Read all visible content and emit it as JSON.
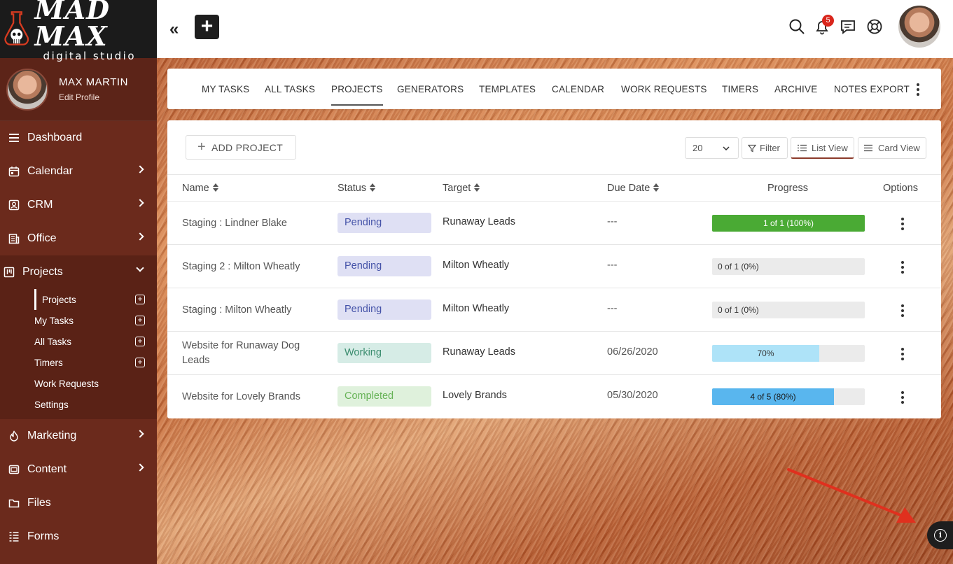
{
  "brand": {
    "name": "MAD MAX",
    "tagline": "digital studio"
  },
  "profile": {
    "name": "MAX MARTIN",
    "edit_label": "Edit Profile"
  },
  "sidebar": {
    "items": [
      {
        "label": "Dashboard",
        "icon": "menu-lines-icon"
      },
      {
        "label": "Calendar",
        "icon": "calendar-icon"
      },
      {
        "label": "CRM",
        "icon": "contact-card-icon"
      },
      {
        "label": "Office",
        "icon": "office-building-icon"
      },
      {
        "label": "Projects",
        "icon": "projects-board-icon"
      },
      {
        "label": "Marketing",
        "icon": "flame-icon"
      },
      {
        "label": "Content",
        "icon": "content-window-icon"
      },
      {
        "label": "Files",
        "icon": "folder-icon"
      },
      {
        "label": "Forms",
        "icon": "form-list-icon"
      }
    ],
    "project_subitems": [
      {
        "label": "Projects",
        "has_add": true
      },
      {
        "label": "My Tasks",
        "has_add": true
      },
      {
        "label": "All Tasks",
        "has_add": true
      },
      {
        "label": "Timers",
        "has_add": true
      },
      {
        "label": "Work Requests",
        "has_add": false
      },
      {
        "label": "Settings",
        "has_add": false
      }
    ]
  },
  "topbar": {
    "notification_count": "5"
  },
  "tabs": [
    "MY TASKS",
    "ALL TASKS",
    "PROJECTS",
    "GENERATORS",
    "TEMPLATES",
    "CALENDAR",
    "WORK REQUESTS",
    "TIMERS",
    "ARCHIVE",
    "NOTES EXPORT"
  ],
  "active_tab": "PROJECTS",
  "toolbar": {
    "add_project": "ADD PROJECT",
    "page_size": "20",
    "filter": "Filter",
    "list_view": "List View",
    "card_view": "Card View"
  },
  "table": {
    "headers": {
      "name": "Name",
      "status": "Status",
      "target": "Target",
      "due": "Due Date",
      "progress": "Progress",
      "options": "Options"
    },
    "rows": [
      {
        "name": "Staging : Lindner Blake",
        "status": "Pending",
        "target": "Runaway Leads",
        "due": "---",
        "progress_label": "1 of 1 (100%)",
        "progress": 1.0,
        "bar_color": "#4aaa34",
        "label_color": "#ffffff"
      },
      {
        "name": "Staging 2 : Milton Wheatly",
        "status": "Pending",
        "target": "Milton Wheatly",
        "due": "---",
        "progress_label": "0 of 1 (0%)",
        "progress": 0.0,
        "bar_color": "#4aaa34",
        "label_color": "#333333"
      },
      {
        "name": "Staging : Milton Wheatly",
        "status": "Pending",
        "target": "Milton Wheatly",
        "due": "---",
        "progress_label": "0 of 1 (0%)",
        "progress": 0.0,
        "bar_color": "#4aaa34",
        "label_color": "#333333"
      },
      {
        "name": "Website for Runaway Dog Leads",
        "status": "Working",
        "target": "Runaway Leads",
        "due": "06/26/2020",
        "progress_label": "70%",
        "progress": 0.7,
        "bar_color": "#aee3f8",
        "label_color": "#333333"
      },
      {
        "name": "Website for Lovely Brands",
        "status": "Completed",
        "target": "Lovely Brands",
        "due": "05/30/2020",
        "progress_label": "4 of 5 (80%)",
        "progress": 0.8,
        "bar_color": "#59b6ee",
        "label_color": "#1a1a1a"
      }
    ]
  }
}
